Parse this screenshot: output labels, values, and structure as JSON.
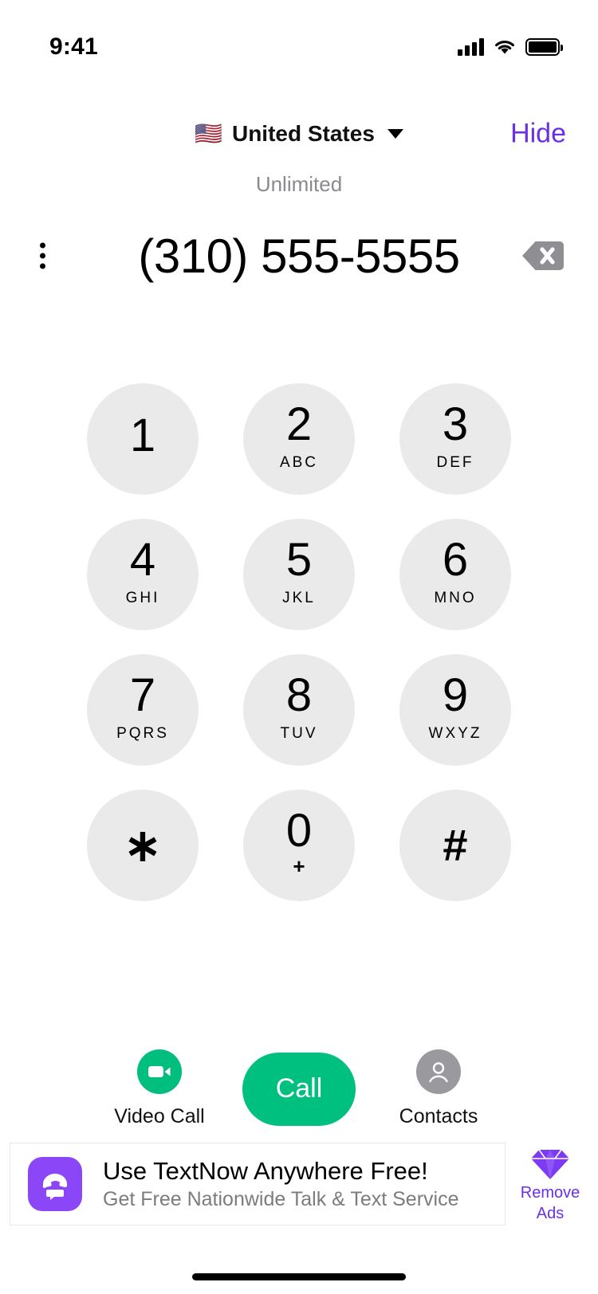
{
  "status_bar": {
    "time": "9:41",
    "signal_icon": "cellular-signal-icon",
    "wifi_icon": "wifi-icon",
    "battery_icon": "battery-full-icon"
  },
  "header": {
    "flag": "🇺🇸",
    "country": "United States",
    "dropdown_icon": "chevron-down-icon",
    "hide_label": "Hide",
    "hide_color": "#6B2FE8"
  },
  "dialer": {
    "plan_label": "Unlimited",
    "phone_number": "(310) 555-5555",
    "menu_icon": "kebab-menu-icon",
    "backspace_icon": "backspace-icon"
  },
  "keypad": {
    "rows": [
      [
        {
          "digit": "1",
          "sub": ""
        },
        {
          "digit": "2",
          "sub": "ABC"
        },
        {
          "digit": "3",
          "sub": "DEF"
        }
      ],
      [
        {
          "digit": "4",
          "sub": "GHI"
        },
        {
          "digit": "5",
          "sub": "JKL"
        },
        {
          "digit": "6",
          "sub": "MNO"
        }
      ],
      [
        {
          "digit": "7",
          "sub": "PQRS"
        },
        {
          "digit": "8",
          "sub": "TUV"
        },
        {
          "digit": "9",
          "sub": "WXYZ"
        }
      ],
      [
        {
          "digit": "∗",
          "sub": ""
        },
        {
          "digit": "0",
          "sub": "+"
        },
        {
          "digit": "#",
          "sub": ""
        }
      ]
    ],
    "key_bg": "#EAEAEA"
  },
  "actions": {
    "video_call_label": "Video Call",
    "video_call_icon": "video-camera-icon",
    "call_label": "Call",
    "call_color": "#00C07F",
    "contacts_label": "Contacts",
    "contacts_icon": "person-icon"
  },
  "ad": {
    "app_icon": "textnow-app-icon",
    "title": "Use TextNow Anywhere Free!",
    "subtitle": "Get Free Nationwide Talk & Text Service",
    "remove_ads_line1": "Remove",
    "remove_ads_line2": "Ads",
    "diamond_icon": "diamond-gem-icon",
    "brand_purple": "#8B46F7"
  }
}
